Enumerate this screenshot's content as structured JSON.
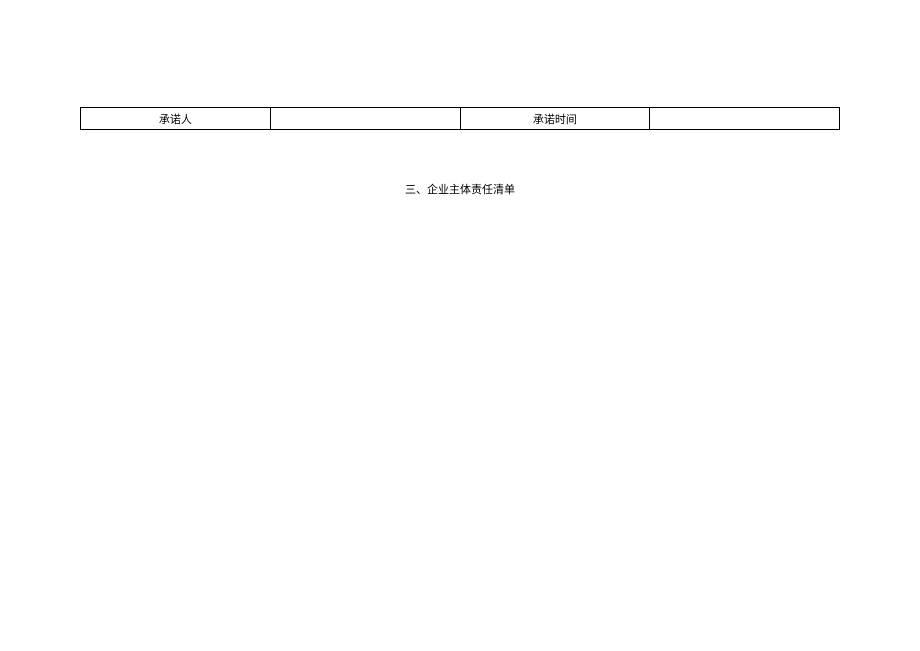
{
  "table": {
    "row1": {
      "col1_label": "承诺人",
      "col2_value": "",
      "col3_label": "承诺时间",
      "col4_value": ""
    }
  },
  "section": {
    "title": "三、企业主体责任清单"
  }
}
